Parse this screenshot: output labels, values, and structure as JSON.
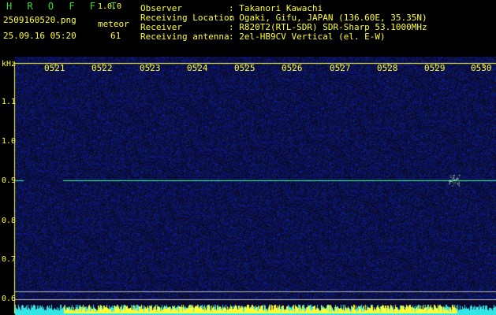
{
  "header": {
    "app_title": "H R O F F T",
    "version": "1.0.0",
    "filename": "2509160520.png",
    "datetime": "25.09.16 05:20",
    "meteor_label": "meteor",
    "meteor_count": "61",
    "info": [
      {
        "label": "Observer",
        "value": ": Takanori Kawachi"
      },
      {
        "label": "Receiving Location",
        "value": ": Ogaki, Gifu, JAPAN (136.60E, 35.35N)"
      },
      {
        "label": "Receiver",
        "value": ": R820T2(RTL-SDR) SDR-Sharp 53.1000MHz"
      },
      {
        "label": "Receiving antenna",
        "value": ": 2el-HB9CV Vertical (el. E-W)"
      }
    ]
  },
  "spectrogram": {
    "y_unit": "kHz",
    "time_ticks": [
      "0521",
      "0522",
      "0523",
      "0524",
      "0525",
      "0526",
      "0527",
      "0528",
      "0529",
      "0530"
    ],
    "freq_ticks": [
      "1.1",
      "1.0",
      "0.9",
      "0.8",
      "0.7",
      "0.6"
    ],
    "colors": {
      "background": "#0a0a2e",
      "noise": "#1a1a88",
      "carrier": "#33ff99",
      "frame": "#ffff33",
      "bottom_bar": "#33e6e6"
    }
  }
}
